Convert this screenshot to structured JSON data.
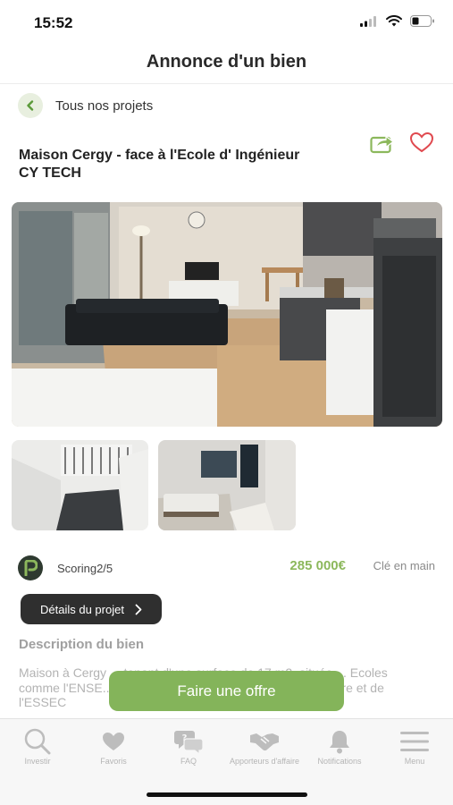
{
  "status_bar": {
    "time": "15:52"
  },
  "header": {
    "title": "Annonce d'un bien"
  },
  "back": {
    "label": "Tous nos projets"
  },
  "listing": {
    "title": "Maison Cergy - face à l'Ecole d' Ingénieur CY TECH",
    "scoring": "Scoring2/5",
    "price": "285 000€",
    "condition": "Clé en main",
    "details_button": "Détails du projet",
    "description_title": "Description du bien",
    "description": "Maison à Cergy ... tenant d'une surface de 17 m2, située ... Ecoles comme l'ENSE... utes à pied de la gare de Cergy-Préfecture et de l'ESSEC"
  },
  "photos": {
    "main": {
      "icon": "apartment-living-room-photo"
    },
    "thumbs": [
      {
        "icon": "staircase-photo"
      },
      {
        "icon": "bedroom-photo"
      }
    ]
  },
  "offer_button": {
    "label": "Faire une offre"
  },
  "tabs": [
    {
      "label": "Investir",
      "icon": "search-icon"
    },
    {
      "label": "Favoris",
      "icon": "heart-icon"
    },
    {
      "label": "FAQ",
      "icon": "faq-icon"
    },
    {
      "label": "Apporteurs d'affaire",
      "icon": "handshake-icon"
    },
    {
      "label": "Notifications",
      "icon": "bell-icon"
    },
    {
      "label": "Menu",
      "icon": "menu-icon"
    }
  ],
  "colors": {
    "accent": "#84b45a",
    "price": "#8cb85c",
    "dark_button": "#2f2f2f",
    "heart": "#e0494f"
  }
}
